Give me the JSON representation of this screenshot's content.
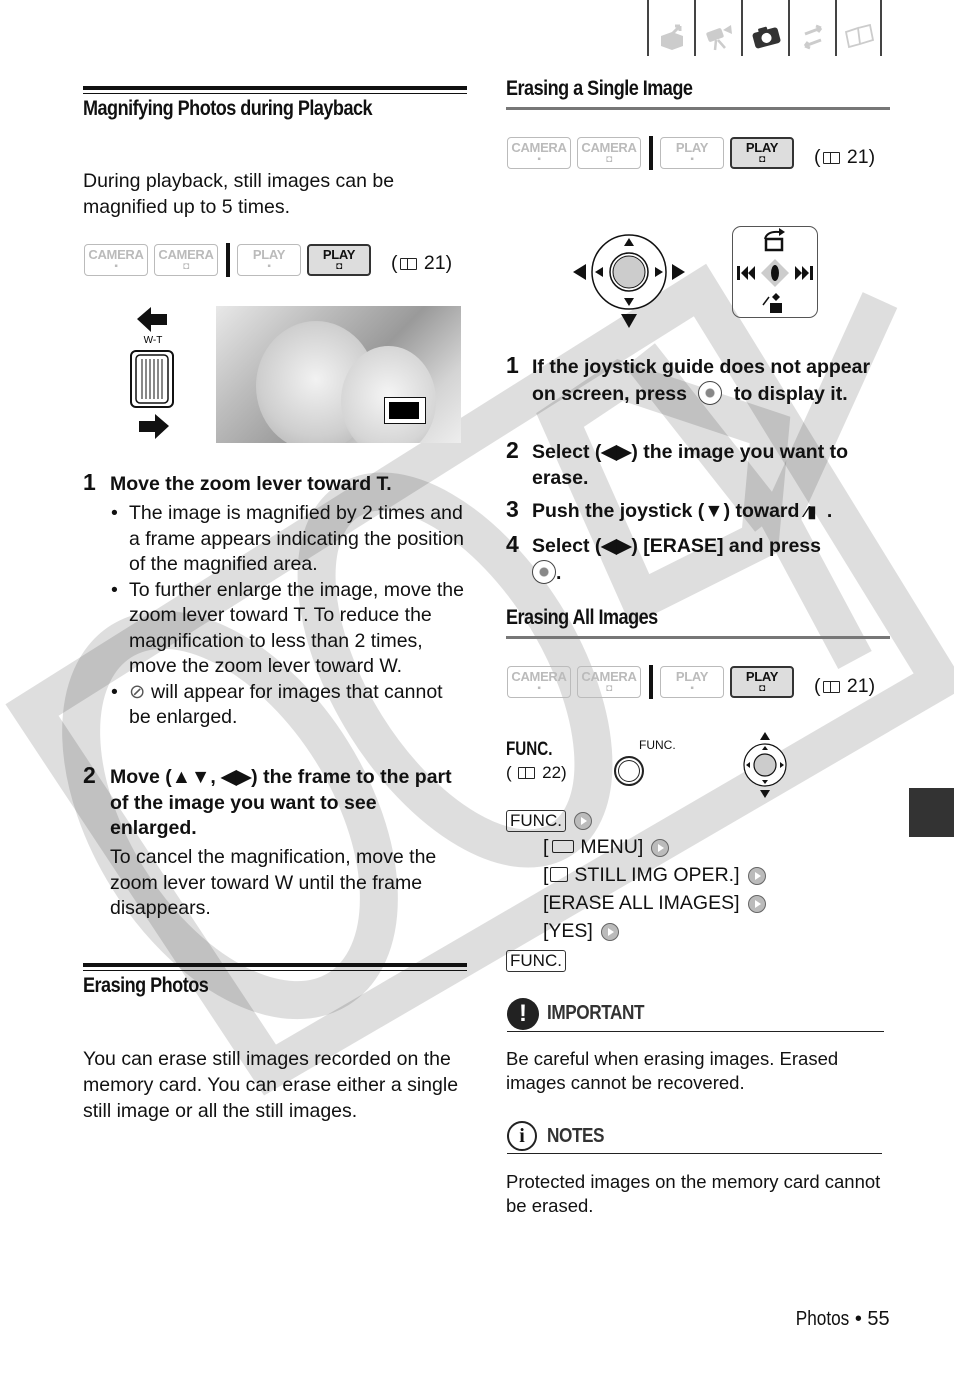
{
  "top_tabs": [
    {
      "icon": "box-arrow-icon",
      "active": false
    },
    {
      "icon": "movie-camera-icon",
      "active": false
    },
    {
      "icon": "still-camera-icon",
      "active": true
    },
    {
      "icon": "transfer-arrows-icon",
      "active": false
    },
    {
      "icon": "open-book-icon",
      "active": false
    }
  ],
  "watermark": "COPY",
  "left": {
    "magnify": {
      "title": "Magnifying Photos during Playback",
      "intro": "During playback, still images can be magnified up to 5 times.",
      "modes": [
        {
          "label": "CAMERA",
          "sub": "movie",
          "active": false
        },
        {
          "label": "CAMERA",
          "sub": "photo",
          "active": false
        },
        {
          "label": "PLAY",
          "sub": "movie",
          "active": false
        },
        {
          "label": "PLAY",
          "sub": "photo",
          "active": true
        }
      ],
      "ref_page": "21",
      "zoom_lever_label": "W-T",
      "steps": [
        {
          "num": "1",
          "text": "Move the zoom lever toward T.",
          "bullets": [
            "The image is magnified by 2 times and a frame appears indicating the position of the magnified area.",
            "To further enlarge the image, move the zoom lever toward T. To reduce the magnification to less than 2 times, move the zoom lever toward W.",
            "will appear for images that cannot be enlarged."
          ]
        },
        {
          "num": "2",
          "text": "Move (▲▼, ◀▶) the frame to the part of the image you want to see enlarged.",
          "note": "To cancel the magnification, move the zoom lever toward W until the frame disappears."
        }
      ]
    },
    "erasing": {
      "title": "Erasing Photos",
      "intro": "You can erase still images recorded on the memory card. You can erase either a single still image or all the still images."
    }
  },
  "right": {
    "single": {
      "title": "Erasing a Single Image",
      "ref_page": "21",
      "steps": [
        {
          "num": "1",
          "text_a": "If the joystick guide does not appear on screen, press",
          "text_b": "to display it."
        },
        {
          "num": "2",
          "text": "Select (◀▶) the image you want to erase."
        },
        {
          "num": "3",
          "text_a": "Push the joystick (▼) toward",
          "text_b": "."
        },
        {
          "num": "4",
          "text_a": "Select (◀▶) [ERASE] and press",
          "text_b": "."
        }
      ]
    },
    "all": {
      "title": "Erasing All Images",
      "ref_page": "21",
      "func_label": "FUNC.",
      "func_ref_page": "22",
      "func_button_caption": "FUNC.",
      "menu": {
        "start": "FUNC.",
        "items": [
          "MENU]",
          "STILL IMG OPER.]",
          "[ERASE ALL IMAGES]",
          "[YES]"
        ],
        "end": "FUNC."
      }
    },
    "important": {
      "title": "IMPORTANT",
      "text": "Be careful when erasing images. Erased images cannot be recovered."
    },
    "notes": {
      "title": "NOTES",
      "text": "Protected images on the memory card cannot be erased."
    }
  },
  "footer": {
    "section": "Photos",
    "page": "55"
  }
}
